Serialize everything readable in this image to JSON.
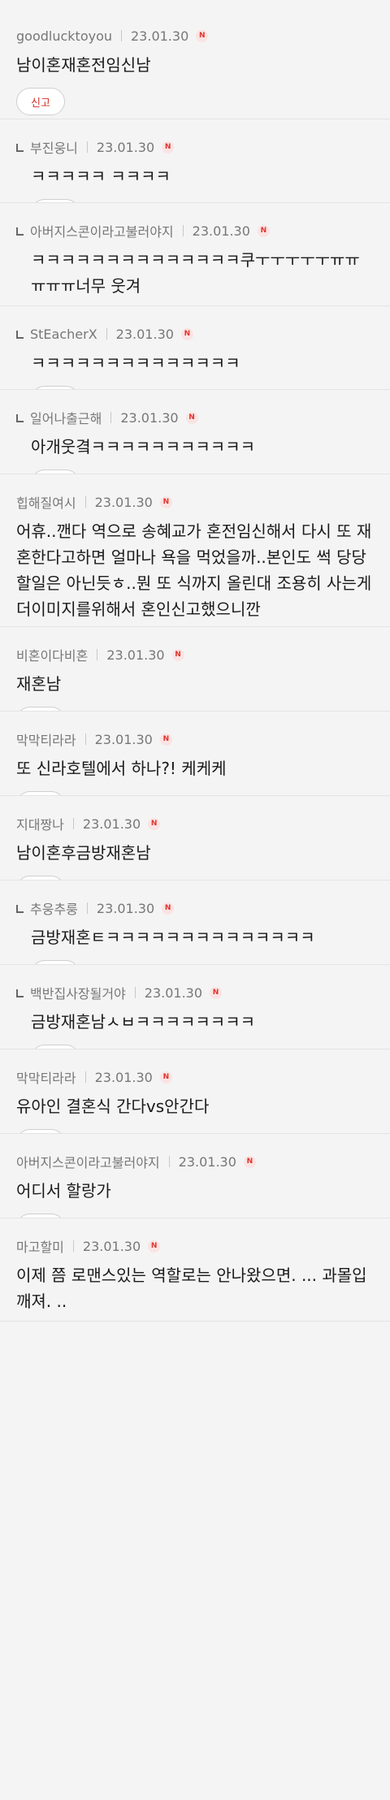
{
  "report_label": "신고",
  "badge_label": "N",
  "comments": [
    {
      "user": "goodlucktoyou",
      "date": "23.01.30",
      "text": "남이혼재혼전임신남",
      "reply": false
    },
    {
      "user": "부진웅니",
      "date": "23.01.30",
      "text": "ㅋㅋㅋㅋㅋ ㅋㅋㅋㅋ",
      "reply": true
    },
    {
      "user": "아버지스콘이라고불러야지",
      "date": "23.01.30",
      "text": "ㅋㅋㅋㅋㅋㅋㅋㅋㅋㅋㅋㅋㅋㅋ쿠ㅜㅜㅜㅜㅜㅠㅠㅠㅠㅠ너무 웃겨",
      "reply": true
    },
    {
      "user": "StEacherX",
      "date": "23.01.30",
      "text": "ㅋㅋㅋㅋㅋㅋㅋㅋㅋㅋㅋㅋㅋㅋ",
      "reply": true
    },
    {
      "user": "일어나출근해",
      "date": "23.01.30",
      "text": "아개웃곀ㅋㅋㅋㅋㅋㅋㅋㅋㅋㅋㅋ",
      "reply": true
    },
    {
      "user": "힙해질여시",
      "date": "23.01.30",
      "text": "어휴..깬다 역으로 송혜교가 혼전임신해서 다시 또 재혼한다고하면 얼마나 욕을 먹었을까..본인도 썩 당당할일은 아닌듯ㅎ..뭔 또 식까지 올린대 조용히 사는게 더이미지를위해서 혼인신고했으니깐",
      "reply": false
    },
    {
      "user": "비혼이다비혼",
      "date": "23.01.30",
      "text": "재혼남",
      "reply": false
    },
    {
      "user": "막막티라라",
      "date": "23.01.30",
      "text": "또 신라호텔에서 하나?! 케케케",
      "reply": false
    },
    {
      "user": "지대짱나",
      "date": "23.01.30",
      "text": "남이혼후금방재혼남",
      "reply": false
    },
    {
      "user": "추웅추룽",
      "date": "23.01.30",
      "text": "금방재혼ㅌㅋㅋㅋㅋㅋㅋㅋㅋㅋㅋㅋㅋㅋㅋ",
      "reply": true
    },
    {
      "user": "백반집사장될거야",
      "date": "23.01.30",
      "text": "금방재혼남ㅅㅂㅋㅋㅋㅋㅋㅋㅋㅋ",
      "reply": true
    },
    {
      "user": "막막티라라",
      "date": "23.01.30",
      "text": "유아인 결혼식 간다vs안간다",
      "reply": false
    },
    {
      "user": "아버지스콘이라고불러야지",
      "date": "23.01.30",
      "text": "어디서 할랑가",
      "reply": false
    },
    {
      "user": "마고할미",
      "date": "23.01.30",
      "text": "이제 쯤 로맨스있는 역할로는 안나왔으면. ... 과몰입깨져. ..",
      "reply": false
    }
  ]
}
